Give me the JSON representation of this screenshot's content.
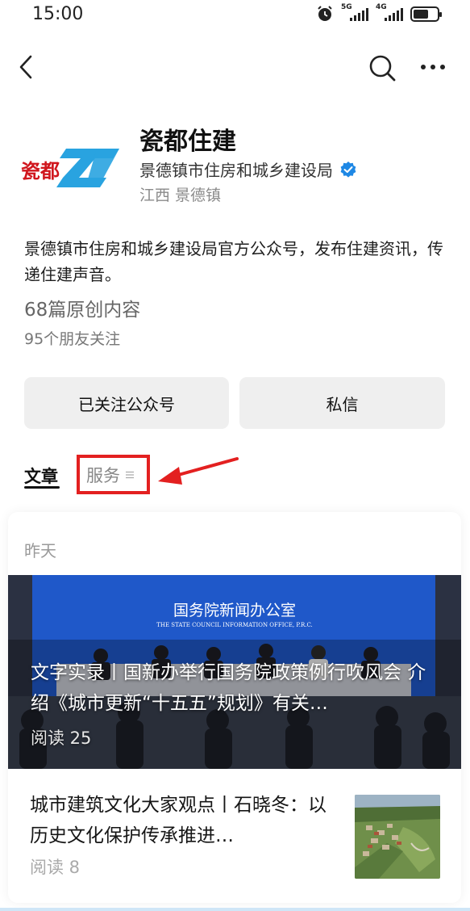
{
  "status_bar": {
    "time": "15:00",
    "network_1": "5G",
    "network_2": "4G",
    "battery_level": 0.65
  },
  "nav": {
    "back_icon": "chevron-left-icon",
    "search_icon": "search-icon",
    "more_icon": "more-dots-icon"
  },
  "profile": {
    "logo_text": "瓷都",
    "name": "瓷都住建",
    "organization": "景德镇市住房和城乡建设局",
    "verified_icon": "verified-check-icon",
    "location": "江西 景德镇",
    "description": "景德镇市住房和城乡建设局官方公众号，发布住建资讯，传递住建声音。",
    "original_count": "68篇原创内容",
    "friends_following": "95个朋友关注"
  },
  "actions": {
    "follow_label": "已关注公众号",
    "message_label": "私信"
  },
  "tabs": {
    "articles": "文章",
    "services": "服务"
  },
  "colors": {
    "verified_blue": "#1e88e5",
    "annotation_red": "#e32020",
    "logo_blue": "#29a3e0",
    "logo_red": "#d0161d",
    "stage_blue": "#1f58c9"
  },
  "feed": {
    "date_label": "昨天",
    "articles": [
      {
        "title": "文字实录丨国新办举行国务院政策例行吹风会 介绍《城市更新“十五五”规划》有关…",
        "reads": "阅读 25",
        "cover_banner_cn": "国务院新闻办公室",
        "cover_banner_en": "THE STATE COUNCIL INFORMATION OFFICE, P.R.C."
      },
      {
        "title": "城市建筑文化大家观点丨石晓冬：以历史文化保护传承推进…",
        "reads": "阅读 8"
      }
    ]
  }
}
